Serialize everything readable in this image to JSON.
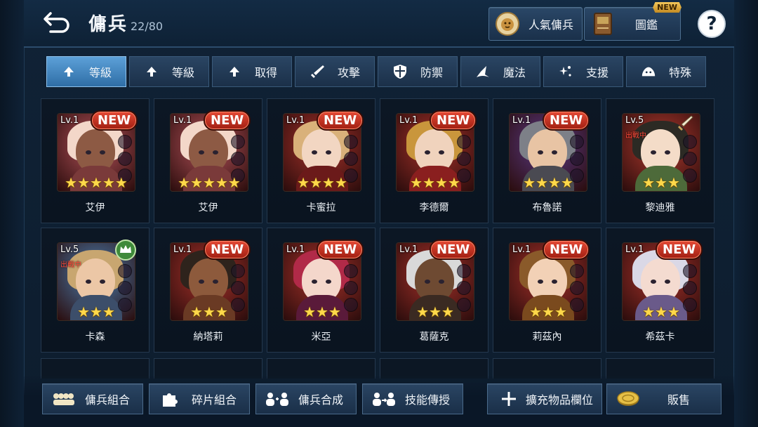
{
  "header": {
    "title": "傭兵",
    "count": "22/80",
    "popular_label": "人氣傭兵",
    "book_label": "圖鑑",
    "book_badge": "NEW",
    "help_label": "?"
  },
  "filters": [
    {
      "label": "等級",
      "icon": "arrow-up-icon",
      "active": true
    },
    {
      "label": "等級",
      "icon": "arrow-up-icon",
      "active": false
    },
    {
      "label": "取得",
      "icon": "arrow-up-icon",
      "active": false
    },
    {
      "label": "攻擊",
      "icon": "sword-icon",
      "active": false
    },
    {
      "label": "防禦",
      "icon": "shield-icon",
      "active": false
    },
    {
      "label": "魔法",
      "icon": "wizard-hat-icon",
      "active": false
    },
    {
      "label": "支援",
      "icon": "sparkle-icon",
      "active": false
    },
    {
      "label": "特殊",
      "icon": "slime-icon",
      "active": false
    }
  ],
  "heroes": [
    {
      "name": "艾伊",
      "level": "Lv.1",
      "stars": 5,
      "badge": "NEW",
      "deployed": "",
      "bg": "#b5535a",
      "hair": "#f3d7c9",
      "skin": "#8d5a44",
      "body": "#7a3a3a"
    },
    {
      "name": "艾伊",
      "level": "Lv.1",
      "stars": 5,
      "badge": "NEW",
      "deployed": "",
      "bg": "#b5535a",
      "hair": "#f3d7c9",
      "skin": "#8d5a44",
      "body": "#7a3a3a"
    },
    {
      "name": "卡蜜拉",
      "level": "Lv.1",
      "stars": 4,
      "badge": "NEW",
      "deployed": "",
      "bg": "#a8322a",
      "hair": "#d9b17a",
      "skin": "#f2d6c2",
      "body": "#6b1a1a"
    },
    {
      "name": "李德爾",
      "level": "Lv.1",
      "stars": 4,
      "badge": "NEW",
      "deployed": "",
      "bg": "#a8322a",
      "hair": "#c9963c",
      "skin": "#f0d3bd",
      "body": "#8a1f1f"
    },
    {
      "name": "布魯諾",
      "level": "Lv.1",
      "stars": 4,
      "badge": "NEW",
      "deployed": "",
      "bg": "#5a3a86",
      "hair": "#7d8088",
      "skin": "#e8c4a4",
      "body": "#4a4a52"
    },
    {
      "name": "黎迪雅",
      "level": "Lv.5",
      "stars": 3,
      "badge": "",
      "deployed": "出戰中",
      "bg": "#b23a2e",
      "hair": "#2c2a24",
      "skin": "#f4dcc8",
      "body": "#4d6a3a",
      "corner": "sword"
    },
    {
      "name": "卡森",
      "level": "Lv.5",
      "stars": 3,
      "badge": "",
      "deployed": "出戰中",
      "bg": "#4b7fb0",
      "hair": "#c8a670",
      "skin": "#ecc7a6",
      "body": "#3c4e6a",
      "corner": "crown"
    },
    {
      "name": "納塔莉",
      "level": "Lv.1",
      "stars": 3,
      "badge": "NEW",
      "deployed": "",
      "bg": "#a8322a",
      "hair": "#2e231c",
      "skin": "#8d5a3c",
      "body": "#6a3a24"
    },
    {
      "name": "米亞",
      "level": "Lv.1",
      "stars": 3,
      "badge": "NEW",
      "deployed": "",
      "bg": "#a8322a",
      "hair": "#b12a48",
      "skin": "#f4d7cb",
      "body": "#5a1a3a"
    },
    {
      "name": "葛薩克",
      "level": "Lv.1",
      "stars": 3,
      "badge": "NEW",
      "deployed": "",
      "bg": "#a8322a",
      "hair": "#d9d9d9",
      "skin": "#6e4a32",
      "body": "#3a2a22"
    },
    {
      "name": "莉茲內",
      "level": "Lv.1",
      "stars": 3,
      "badge": "NEW",
      "deployed": "",
      "bg": "#a8322a",
      "hair": "#8a5a2a",
      "skin": "#f2d1b6",
      "body": "#7a4a1e"
    },
    {
      "name": "希茲卡",
      "level": "Lv.1",
      "stars": 3,
      "badge": "NEW",
      "deployed": "",
      "bg": "#a8322a",
      "hair": "#dad8e6",
      "skin": "#f4dbd0",
      "body": "#6a5a8a"
    }
  ],
  "bottom_buttons": [
    {
      "label": "傭兵組合",
      "icon": "squad-icon"
    },
    {
      "label": "碎片組合",
      "icon": "puzzle-icon"
    },
    {
      "label": "傭兵合成",
      "icon": "merge-icon"
    },
    {
      "label": "技能傳授",
      "icon": "transfer-icon"
    },
    {
      "label": "擴充物品欄位",
      "icon": "plus-icon"
    },
    {
      "label": "販售",
      "icon": "gold-coin-icon"
    }
  ]
}
